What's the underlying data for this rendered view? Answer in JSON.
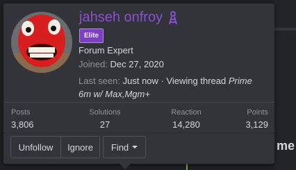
{
  "background": {
    "heading_fragment": "me"
  },
  "profile": {
    "username": "jahseh onfroy",
    "username_icon": "ladder-badge-icon",
    "banner": "Elite",
    "user_title": "Forum Expert",
    "joined_label": "Joined:",
    "joined_value": "Dec 27, 2020",
    "last_seen_label": "Last seen:",
    "last_seen_value": "Just now · Viewing thread",
    "last_seen_thread": "Prime 6m w/ Max,Mgm+",
    "accent_color": "#8a4fd3"
  },
  "stats": [
    {
      "label": "Posts",
      "value": "3,806"
    },
    {
      "label": "Solutions",
      "value": "27"
    },
    {
      "label": "Reaction",
      "value": "14,280"
    },
    {
      "label": "Points",
      "value": "3,129"
    }
  ],
  "actions": {
    "unfollow": "Unfollow",
    "ignore": "Ignore",
    "find": "Find"
  }
}
